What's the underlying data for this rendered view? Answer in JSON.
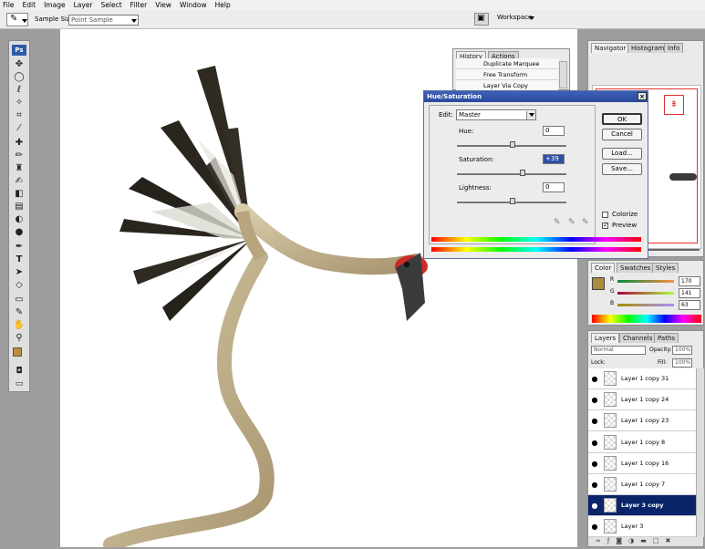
{
  "menu": [
    "File",
    "Edit",
    "Image",
    "Layer",
    "Select",
    "Filter",
    "View",
    "Window",
    "Help"
  ],
  "options": {
    "sample_size_label": "Sample Size:",
    "sample_size_value": "Point Sample",
    "workspace_label": "Workspace"
  },
  "toolbox": {
    "logo": "Ps"
  },
  "history": {
    "tabs": [
      "History",
      "Actions"
    ],
    "items": [
      "Duplicate Marquee",
      "Free Transform",
      "Layer Via Copy"
    ]
  },
  "navigator": {
    "tabs": [
      "Navigator",
      "Histogram",
      "Info"
    ]
  },
  "color": {
    "tabs": [
      "Color",
      "Swatches",
      "Styles"
    ],
    "r_label": "R",
    "g_label": "G",
    "b_label": "B",
    "r": "170",
    "g": "141",
    "b": "63",
    "swatch": "#aa8d3f"
  },
  "layers": {
    "tabs": [
      "Layers",
      "Channels",
      "Paths"
    ],
    "blend": "Normal",
    "opacity_label": "Opacity:",
    "opacity": "100%",
    "lock_label": "Lock:",
    "fill_label": "Fill:",
    "fill": "100%",
    "rows": [
      "Layer 1 copy 31",
      "Layer 1 copy 24",
      "Layer 1 copy 23",
      "Layer 1 copy 8",
      "Layer 1 copy 16",
      "Layer 1 copy 7",
      "Layer 3 copy",
      "Layer 3"
    ],
    "selected_index": 6
  },
  "dialog": {
    "title": "Hue/Saturation",
    "edit_label": "Edit:",
    "edit_value": "Master",
    "hue_label": "Hue:",
    "hue": "0",
    "sat_label": "Saturation:",
    "sat": "+39",
    "light_label": "Lightness:",
    "light": "0",
    "hue_pos": 0.5,
    "sat_pos": 0.6,
    "light_pos": 0.5,
    "ok": "OK",
    "cancel": "Cancel",
    "load": "Load...",
    "save": "Save...",
    "colorize_label": "Colorize",
    "colorize": false,
    "preview_label": "Preview",
    "preview": true
  }
}
